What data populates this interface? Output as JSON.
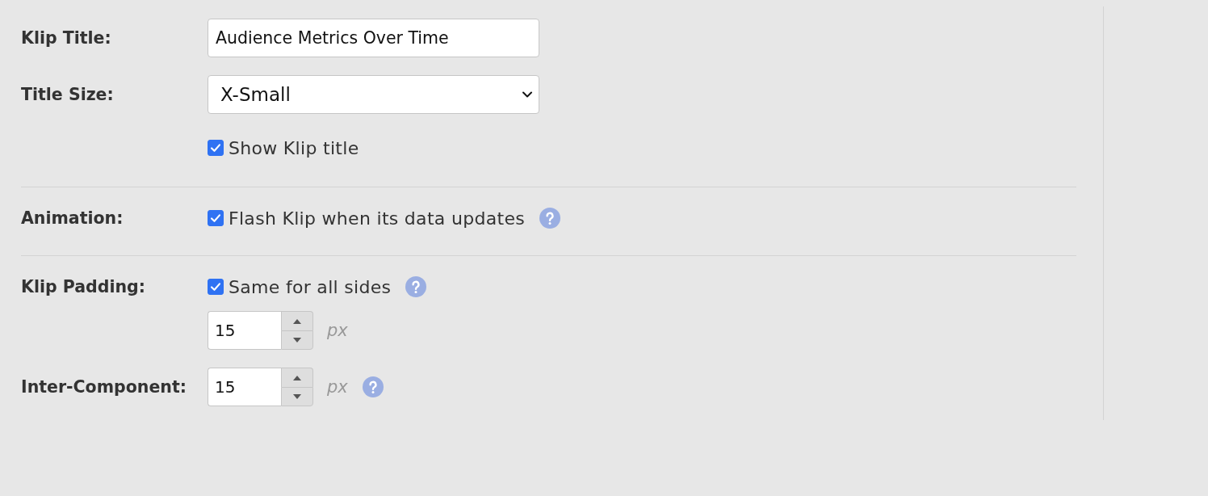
{
  "sections": [
    {
      "rows": [
        {
          "label": "Klip Title:",
          "controls": [
            {
              "kind": "text",
              "value": "Audience Metrics Over Time"
            }
          ]
        },
        {
          "label": "Title Size:",
          "controls": [
            {
              "kind": "select",
              "value": "X-Small"
            }
          ]
        },
        {
          "controls": [
            {
              "kind": "checkbox",
              "label": "Show Klip title",
              "checked": true
            }
          ]
        }
      ]
    },
    {
      "rows": [
        {
          "label": "Animation:",
          "controls": [
            {
              "kind": "checkbox",
              "label": "Flash Klip when its data updates",
              "checked": true,
              "help": true
            }
          ]
        }
      ]
    },
    {
      "rows": [
        {
          "label": "Klip Padding:",
          "controls": [
            {
              "kind": "checkbox",
              "label": "Same for all sides",
              "checked": true,
              "help": true
            }
          ]
        },
        {
          "controls": [
            {
              "kind": "number",
              "value": "15",
              "unit": "px"
            }
          ]
        },
        {
          "label": "Inter-Component:",
          "controls": [
            {
              "kind": "number",
              "value": "15",
              "unit": "px",
              "help": true
            }
          ]
        }
      ]
    }
  ]
}
